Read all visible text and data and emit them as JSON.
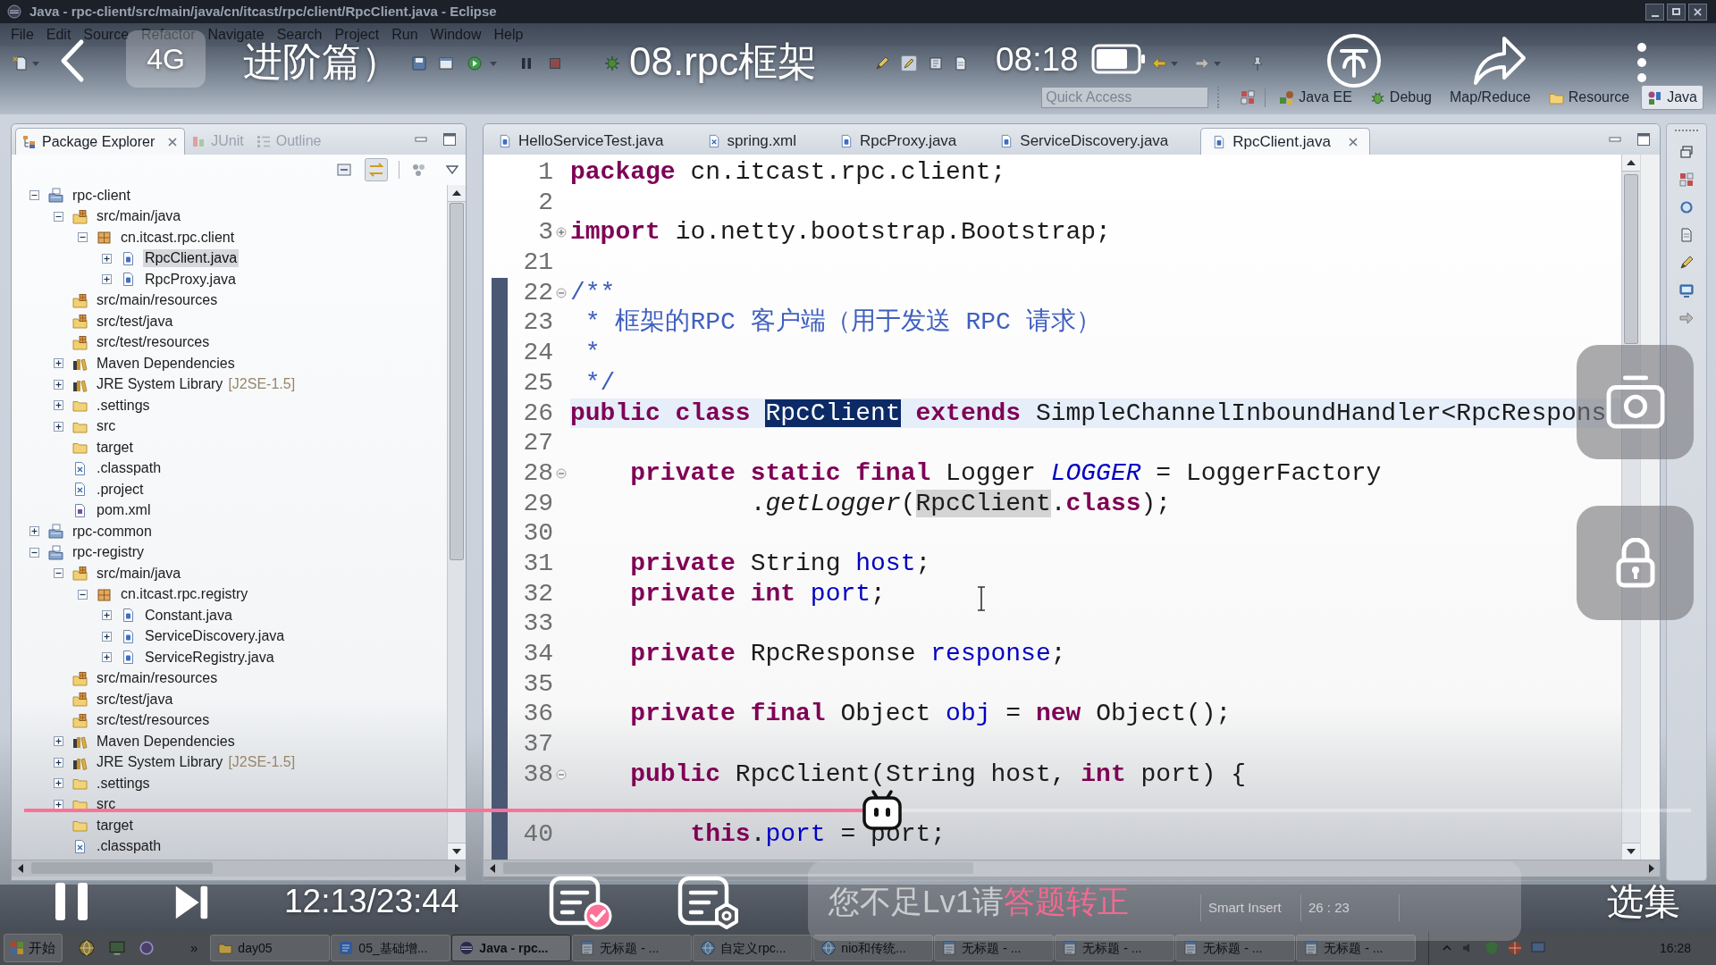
{
  "eclipse": {
    "window_title": "Java - rpc-client/src/main/java/cn/itcast/rpc/client/RpcClient.java - Eclipse",
    "menu": [
      "File",
      "Edit",
      "Source",
      "Refactor",
      "Navigate",
      "Search",
      "Project",
      "Run",
      "Window",
      "Help"
    ],
    "quick_access": {
      "placeholder": "Quick Access"
    },
    "perspectives": [
      {
        "label": "Java EE",
        "kind": "java_ee",
        "selected": false
      },
      {
        "label": "Debug",
        "kind": "debug",
        "selected": false
      },
      {
        "label": "Map/Reduce",
        "kind": "map_reduce",
        "selected": false
      },
      {
        "label": "Resource",
        "kind": "resource",
        "selected": false
      },
      {
        "label": "Java",
        "kind": "java",
        "selected": true
      }
    ],
    "explorer_tabs": [
      {
        "label": "Package Explorer",
        "kind": "package_explorer",
        "selected": true
      },
      {
        "label": "JUnit",
        "kind": "junit",
        "selected": false
      },
      {
        "label": "Outline",
        "kind": "outline",
        "selected": false
      }
    ],
    "tree": [
      {
        "label": "rpc-client",
        "kind": "project",
        "expanded": true,
        "selected": false,
        "children": [
          {
            "label": "src/main/java",
            "kind": "source_folder",
            "expanded": true,
            "selected": false,
            "children": [
              {
                "label": "cn.itcast.rpc.client",
                "kind": "package",
                "expanded": true,
                "selected": false,
                "children": [
                  {
                    "label": "RpcClient.java",
                    "kind": "java",
                    "expanded": false,
                    "selected": true
                  },
                  {
                    "label": "RpcProxy.java",
                    "kind": "java",
                    "expanded": false,
                    "selected": false
                  }
                ]
              }
            ]
          },
          {
            "label": "src/main/resources",
            "kind": "source_folder",
            "selected": false
          },
          {
            "label": "src/test/java",
            "kind": "source_folder",
            "selected": false
          },
          {
            "label": "src/test/resources",
            "kind": "source_folder",
            "selected": false
          },
          {
            "label": "Maven Dependencies",
            "kind": "library",
            "expanded": false,
            "selected": false
          },
          {
            "label": "JRE System Library",
            "decoration": "[J2SE-1.5]",
            "kind": "library",
            "expanded": false,
            "selected": false
          },
          {
            "label": ".settings",
            "kind": "folder",
            "expanded": false,
            "selected": false
          },
          {
            "label": "src",
            "kind": "folder",
            "expanded": false,
            "selected": false
          },
          {
            "label": "target",
            "kind": "folder",
            "selected": false
          },
          {
            "label": ".classpath",
            "kind": "xml",
            "selected": false
          },
          {
            "label": ".project",
            "kind": "xml",
            "selected": false
          },
          {
            "label": "pom.xml",
            "kind": "maven_pom",
            "selected": false
          }
        ]
      },
      {
        "label": "rpc-common",
        "kind": "project",
        "expanded": false,
        "selected": false
      },
      {
        "label": "rpc-registry",
        "kind": "project",
        "expanded": true,
        "selected": false,
        "children": [
          {
            "label": "src/main/java",
            "kind": "source_folder",
            "expanded": true,
            "selected": false,
            "children": [
              {
                "label": "cn.itcast.rpc.registry",
                "kind": "package",
                "expanded": true,
                "selected": false,
                "children": [
                  {
                    "label": "Constant.java",
                    "kind": "java",
                    "expanded": false,
                    "selected": false
                  },
                  {
                    "label": "ServiceDiscovery.java",
                    "kind": "java",
                    "expanded": false,
                    "selected": false
                  },
                  {
                    "label": "ServiceRegistry.java",
                    "kind": "java",
                    "expanded": false,
                    "selected": false
                  }
                ]
              }
            ]
          },
          {
            "label": "src/main/resources",
            "kind": "source_folder",
            "selected": false
          },
          {
            "label": "src/test/java",
            "kind": "source_folder",
            "selected": false
          },
          {
            "label": "src/test/resources",
            "kind": "source_folder",
            "selected": false
          },
          {
            "label": "Maven Dependencies",
            "kind": "library",
            "expanded": false,
            "selected": false
          },
          {
            "label": "JRE System Library",
            "decoration": "[J2SE-1.5]",
            "kind": "library",
            "expanded": false,
            "selected": false
          },
          {
            "label": ".settings",
            "kind": "folder",
            "expanded": false,
            "selected": false
          },
          {
            "label": "src",
            "kind": "folder",
            "expanded": false,
            "selected": false
          },
          {
            "label": "target",
            "kind": "folder",
            "selected": false
          },
          {
            "label": ".classpath",
            "kind": "xml",
            "selected": false
          }
        ]
      }
    ],
    "editor_tabs": [
      {
        "label": "HelloServiceTest.java",
        "kind": "java",
        "selected": false
      },
      {
        "label": "spring.xml",
        "kind": "xml",
        "selected": false
      },
      {
        "label": "RpcProxy.java",
        "kind": "java",
        "selected": false
      },
      {
        "label": "ServiceDiscovery.java",
        "kind": "java",
        "selected": false
      },
      {
        "label": "RpcClient.java",
        "kind": "java",
        "selected": true
      }
    ],
    "code": [
      {
        "number": "1",
        "current": false,
        "tokens": [
          {
            "text": "package",
            "kind": "keyword"
          },
          {
            "text": " cn.itcast.rpc.client;",
            "kind": "plain"
          }
        ]
      },
      {
        "number": "2",
        "current": false
      },
      {
        "number": "3",
        "current": false,
        "collapsed": true,
        "tokens": [
          {
            "text": "import",
            "kind": "keyword"
          },
          {
            "text": " io.netty.bootstrap.Bootstrap;",
            "kind": "plain"
          }
        ]
      },
      {
        "number": "21",
        "current": false
      },
      {
        "number": "22",
        "current": false,
        "collapsed": false,
        "tokens": [
          {
            "text": "/**",
            "kind": "javadoc"
          }
        ]
      },
      {
        "number": "23",
        "current": false,
        "tokens": [
          {
            "text": " * 框架的RPC 客户端（用于发送 RPC 请求）",
            "kind": "javadoc"
          }
        ]
      },
      {
        "number": "24",
        "current": false,
        "tokens": [
          {
            "text": " *",
            "kind": "javadoc"
          }
        ]
      },
      {
        "number": "25",
        "current": false,
        "tokens": [
          {
            "text": " */",
            "kind": "javadoc"
          }
        ]
      },
      {
        "number": "26",
        "current": true,
        "tokens": [
          {
            "text": "public class ",
            "kind": "keyword"
          },
          {
            "text": "RpcClient",
            "kind": "selection"
          },
          {
            "text": " extends",
            "kind": "keyword"
          },
          {
            "text": " SimpleChannelInboundHandler<RpcRespons",
            "kind": "plain"
          }
        ]
      },
      {
        "number": "27",
        "current": false
      },
      {
        "number": "28",
        "current": false,
        "collapsed": false,
        "tokens": [
          {
            "text": "    private static final",
            "kind": "keyword"
          },
          {
            "text": " Logger ",
            "kind": "plain"
          },
          {
            "text": "LOGGER",
            "kind": "static_field"
          },
          {
            "text": " = LoggerFactory",
            "kind": "plain"
          }
        ]
      },
      {
        "number": "29",
        "current": false,
        "tokens": [
          {
            "text": "            .",
            "kind": "plain"
          },
          {
            "text": "getLogger",
            "kind": "static_method"
          },
          {
            "text": "(",
            "kind": "plain"
          },
          {
            "text": "RpcClient",
            "kind": "occurrence"
          },
          {
            "text": ".",
            "kind": "plain"
          },
          {
            "text": "class",
            "kind": "keyword"
          },
          {
            "text": ");",
            "kind": "plain"
          }
        ]
      },
      {
        "number": "30",
        "current": false
      },
      {
        "number": "31",
        "current": false,
        "tokens": [
          {
            "text": "    private",
            "kind": "keyword"
          },
          {
            "text": " String ",
            "kind": "plain"
          },
          {
            "text": "host",
            "kind": "field"
          },
          {
            "text": ";",
            "kind": "plain"
          }
        ]
      },
      {
        "number": "32",
        "current": false,
        "tokens": [
          {
            "text": "    private int",
            "kind": "keyword"
          },
          {
            "text": " port",
            "kind": "field"
          },
          {
            "text": ";",
            "kind": "plain"
          }
        ]
      },
      {
        "number": "33",
        "current": false
      },
      {
        "number": "34",
        "current": false,
        "tokens": [
          {
            "text": "    private",
            "kind": "keyword"
          },
          {
            "text": " RpcResponse ",
            "kind": "plain"
          },
          {
            "text": "response",
            "kind": "field"
          },
          {
            "text": ";",
            "kind": "plain"
          }
        ]
      },
      {
        "number": "35",
        "current": false
      },
      {
        "number": "36",
        "current": false,
        "tokens": [
          {
            "text": "    private final",
            "kind": "keyword"
          },
          {
            "text": " Object ",
            "kind": "plain"
          },
          {
            "text": "obj",
            "kind": "field"
          },
          {
            "text": " = ",
            "kind": "plain"
          },
          {
            "text": "new",
            "kind": "keyword"
          },
          {
            "text": " Object();",
            "kind": "plain"
          }
        ]
      },
      {
        "number": "37",
        "current": false
      },
      {
        "number": "38",
        "current": false,
        "collapsed": false,
        "tokens": [
          {
            "text": "    public",
            "kind": "keyword"
          },
          {
            "text": " RpcClient(String host, ",
            "kind": "plain"
          },
          {
            "text": "int",
            "kind": "keyword"
          },
          {
            "text": " port) {",
            "kind": "plain"
          }
        ]
      },
      {
        "current": false
      },
      {
        "number": "40",
        "current": false,
        "tokens": [
          {
            "text": "        this",
            "kind": "keyword"
          },
          {
            "text": ".",
            "kind": "plain"
          },
          {
            "text": "port",
            "kind": "field"
          },
          {
            "text": " = port;",
            "kind": "plain"
          }
        ]
      }
    ],
    "status_bar": {
      "insert_mode": "Smart Insert",
      "cursor_position": "26 : 23"
    }
  },
  "taskbar": {
    "start": "开始",
    "more": "»",
    "tasks": [
      {
        "label": "day05",
        "kind": "folder",
        "selected": false
      },
      {
        "label": "05_基础增...",
        "kind": "word",
        "selected": false
      },
      {
        "label": "Java - rpc...",
        "kind": "eclipse",
        "selected": true
      },
      {
        "label": "无标题 - ...",
        "kind": "notepad",
        "selected": false
      },
      {
        "label": "自定义rpc...",
        "kind": "browser",
        "selected": false
      },
      {
        "label": "nio和传统...",
        "kind": "browser",
        "selected": false
      },
      {
        "label": "无标题 - ...",
        "kind": "notepad",
        "selected": false
      },
      {
        "label": "无标题 - ...",
        "kind": "notepad",
        "selected": false
      },
      {
        "label": "无标题 - ...",
        "kind": "notepad",
        "selected": false
      },
      {
        "label": "无标题 - ...",
        "kind": "notepad",
        "selected": false
      }
    ],
    "clock": "16:28"
  },
  "player": {
    "network": "4G",
    "title_parts": [
      "进阶篇）",
      "08.rpc框架"
    ],
    "clock": "08:18",
    "progress": {
      "level": 0.515
    },
    "playing": true,
    "time": "12:13/23:44",
    "danmaku_on": true,
    "danmaku_hint": "您不足Lv1请",
    "danmaku_link": "答题转正",
    "episodes": "选集"
  }
}
